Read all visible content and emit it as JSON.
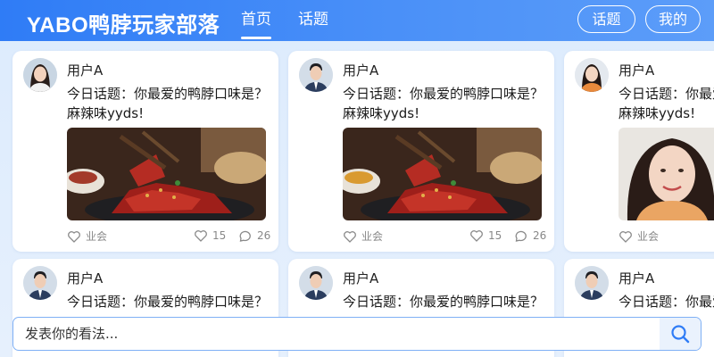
{
  "header": {
    "logo": "YABO鸭脖玩家部落",
    "nav": [
      "首页",
      "话题"
    ],
    "buttons": {
      "topic": "话题",
      "mine": "我的"
    }
  },
  "posts": [
    {
      "user": "用户A",
      "avatar": "female-avatar",
      "text": "今日话题：你最爱的鸭脖口味是？麻辣味yyds!",
      "image": "spicy-duck-neck-photo",
      "like_label": "业会",
      "likes": "15",
      "comments": "26"
    },
    {
      "user": "用户A",
      "avatar": "male-avatar",
      "text": "今日话题：你最爱的鸭脖口味是？麻辣味yyds!",
      "image": "spicy-duck-neck-photo",
      "like_label": "业会",
      "likes": "15",
      "comments": "26"
    },
    {
      "user": "用户A",
      "avatar": "female-avatar",
      "text": "今日话题：你最爱的鸭脖口味是？麻辣味yyds!",
      "image": "woman-portrait-photo",
      "like_label": "业会",
      "likes": "",
      "comments": ""
    },
    {
      "user": "用户A",
      "avatar": "male-avatar",
      "text": "今日话题：你最爱的鸭脖口味是？"
    },
    {
      "user": "用户A",
      "avatar": "male-avatar",
      "text": "今日话题：你最爱的鸭脖口味是？"
    },
    {
      "user": "用户A",
      "avatar": "male-avatar",
      "text": "今日话题：你最爱的鸭脖口味是？"
    }
  ],
  "composer": {
    "placeholder": "发表你的看法...",
    "search_icon": "search-icon"
  },
  "colors": {
    "brand": "#2f7cf6",
    "background": "#dcebfd"
  }
}
